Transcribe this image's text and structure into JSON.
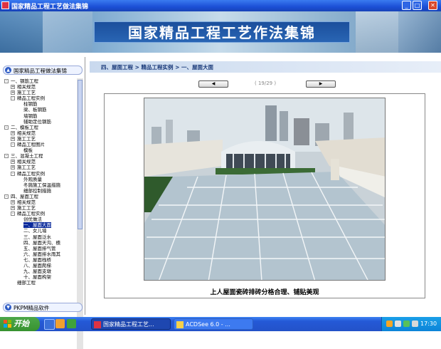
{
  "window": {
    "title": "国家精品工程工艺做法集锦"
  },
  "banner": {
    "title": "国家精品工程工艺作法集锦"
  },
  "sidebar": {
    "header": "国家精品工程做法集锦",
    "footer": "PKPM精品软件",
    "tree": [
      {
        "label": "一、钢筋工程",
        "level": 0,
        "toggle": "-"
      },
      {
        "label": "相关规范",
        "level": 1,
        "toggle": "+"
      },
      {
        "label": "施工工艺",
        "level": 1,
        "toggle": "+"
      },
      {
        "label": "精品工程实例",
        "level": 1,
        "toggle": "-"
      },
      {
        "label": "柱钢筋",
        "level": 2
      },
      {
        "label": "梁、板钢筋",
        "level": 2
      },
      {
        "label": "墙钢筋",
        "level": 2
      },
      {
        "label": "辅助定位钢筋",
        "level": 2
      },
      {
        "label": "二、模板工程",
        "level": 0,
        "toggle": "-"
      },
      {
        "label": "相关规范",
        "level": 1,
        "toggle": "+"
      },
      {
        "label": "施工工艺",
        "level": 1,
        "toggle": "+"
      },
      {
        "label": "精品工程图片",
        "level": 1,
        "toggle": "-"
      },
      {
        "label": "模板",
        "level": 2
      },
      {
        "label": "三、混凝土工程",
        "level": 0,
        "toggle": "-"
      },
      {
        "label": "相关规范",
        "level": 1,
        "toggle": "+"
      },
      {
        "label": "施工工艺",
        "level": 1,
        "toggle": "+"
      },
      {
        "label": "精品工程实例",
        "level": 1,
        "toggle": "-"
      },
      {
        "label": "外观质量",
        "level": 2
      },
      {
        "label": "冬施施工保温措施",
        "level": 2
      },
      {
        "label": "细部控制措施",
        "level": 2
      },
      {
        "label": "四、屋面工程",
        "level": 0,
        "toggle": "-"
      },
      {
        "label": "相关规范",
        "level": 1,
        "toggle": "+"
      },
      {
        "label": "施工工艺",
        "level": 1,
        "toggle": "+"
      },
      {
        "label": "精品工程实例",
        "level": 1,
        "toggle": "-"
      },
      {
        "label": "创优做法",
        "level": 2
      },
      {
        "label": "一、屋面大面",
        "level": 2,
        "selected": true
      },
      {
        "label": "二、女儿墙",
        "level": 2
      },
      {
        "label": "三、屋面泛水",
        "level": 2
      },
      {
        "label": "四、屋面天沟、檐",
        "level": 2
      },
      {
        "label": "五、屋面排气管",
        "level": 2
      },
      {
        "label": "六、屋面排水雨其",
        "level": 2
      },
      {
        "label": "七、屋面栈桥",
        "level": 2
      },
      {
        "label": "八、屋面爬梯",
        "level": 2
      },
      {
        "label": "九、屋面支墩",
        "level": 2
      },
      {
        "label": "十、屋面构架",
        "level": 2
      },
      {
        "label": "细部工程",
        "level": 1
      }
    ]
  },
  "main": {
    "breadcrumb": "四、屋面工程 > 精品工程实例 > 一、屋面大面",
    "prev_button": "◀",
    "next_button": "▶",
    "pager": "( 19/29 )",
    "caption": "上人屋面瓷砖排砖分格合理、铺贴美观"
  },
  "taskbar": {
    "start_label": "开始",
    "tasks": [
      {
        "label": "国家精品工程工艺...",
        "active": true
      },
      {
        "label": "ACDSee 6.0 - ...",
        "active": false
      }
    ],
    "clock": "17:30"
  }
}
